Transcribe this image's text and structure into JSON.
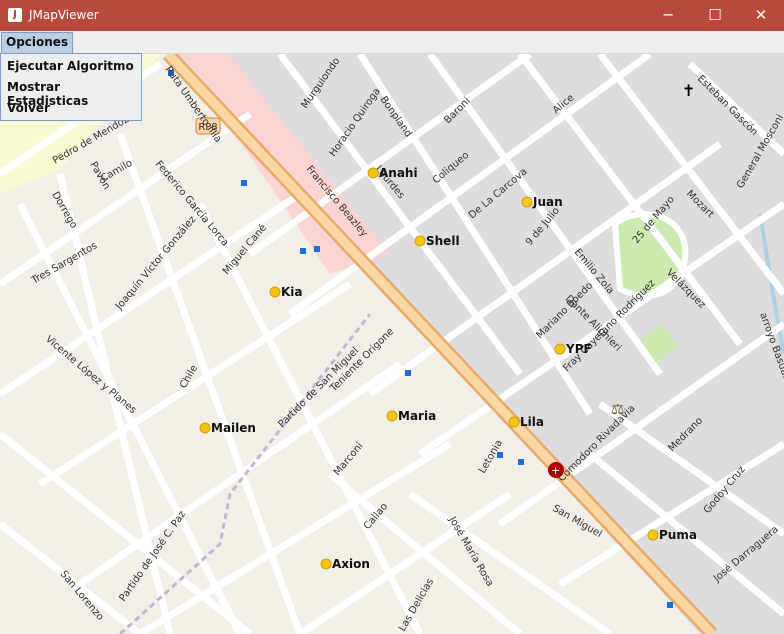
{
  "window": {
    "title": "JMapViewer",
    "app_icon": "java-icon",
    "controls": {
      "minimize": "─",
      "maximize": "☐",
      "close": "✕"
    }
  },
  "menu": {
    "label": "Opciones",
    "items": [
      "Ejecutar Algoritmo",
      "Mostrar Estadisticas",
      "Volver"
    ]
  },
  "map": {
    "markers": [
      {
        "label": "Anahi"
      },
      {
        "label": "Juan"
      },
      {
        "label": "Shell"
      },
      {
        "label": "Kia"
      },
      {
        "label": "YPF"
      },
      {
        "label": "Maria"
      },
      {
        "label": "Lila"
      },
      {
        "label": "Mailen"
      },
      {
        "label": "Puma"
      },
      {
        "label": "Axion"
      }
    ],
    "marker_color": "#f5c518",
    "route_shield": "RP8",
    "street_labels": [
      "Murguiondo",
      "Horacio Quiroga",
      "Bonpland",
      "Lourdes",
      "Baroni",
      "Alice",
      "Esteban Gascón",
      "Pedro de Mendoza",
      "Pavón",
      "Camilo",
      "Dorrego",
      "Federico García Lorca",
      "Francisco Beazley",
      "Coliqueo",
      "De La Carcova",
      "9 de Julio",
      "Emilio Zola",
      "25 de Mayo",
      "Mozart",
      "General Mosconi",
      "Velázquez",
      "Tres Sargentos",
      "Joaquín Víctor González",
      "Miguel Cané",
      "Mariano Boedo",
      "Dante Alighieri",
      "Fray Cayetano Rodríguez",
      "Vicente López y Planes",
      "Chile",
      "Partido de San Miguel",
      "Teniente Origone",
      "Marconi",
      "Callao",
      "Letonia",
      "José María Rosa",
      "Las Delicias",
      "San Lorenzo",
      "Partido de José C. Paz",
      "San Miguel",
      "Comodoro Rivadavia",
      "Godoy Cruz",
      "José Darraguera",
      "arroyo Basualdo",
      "Medrano",
      "Ruta Umberto Illia"
    ]
  }
}
